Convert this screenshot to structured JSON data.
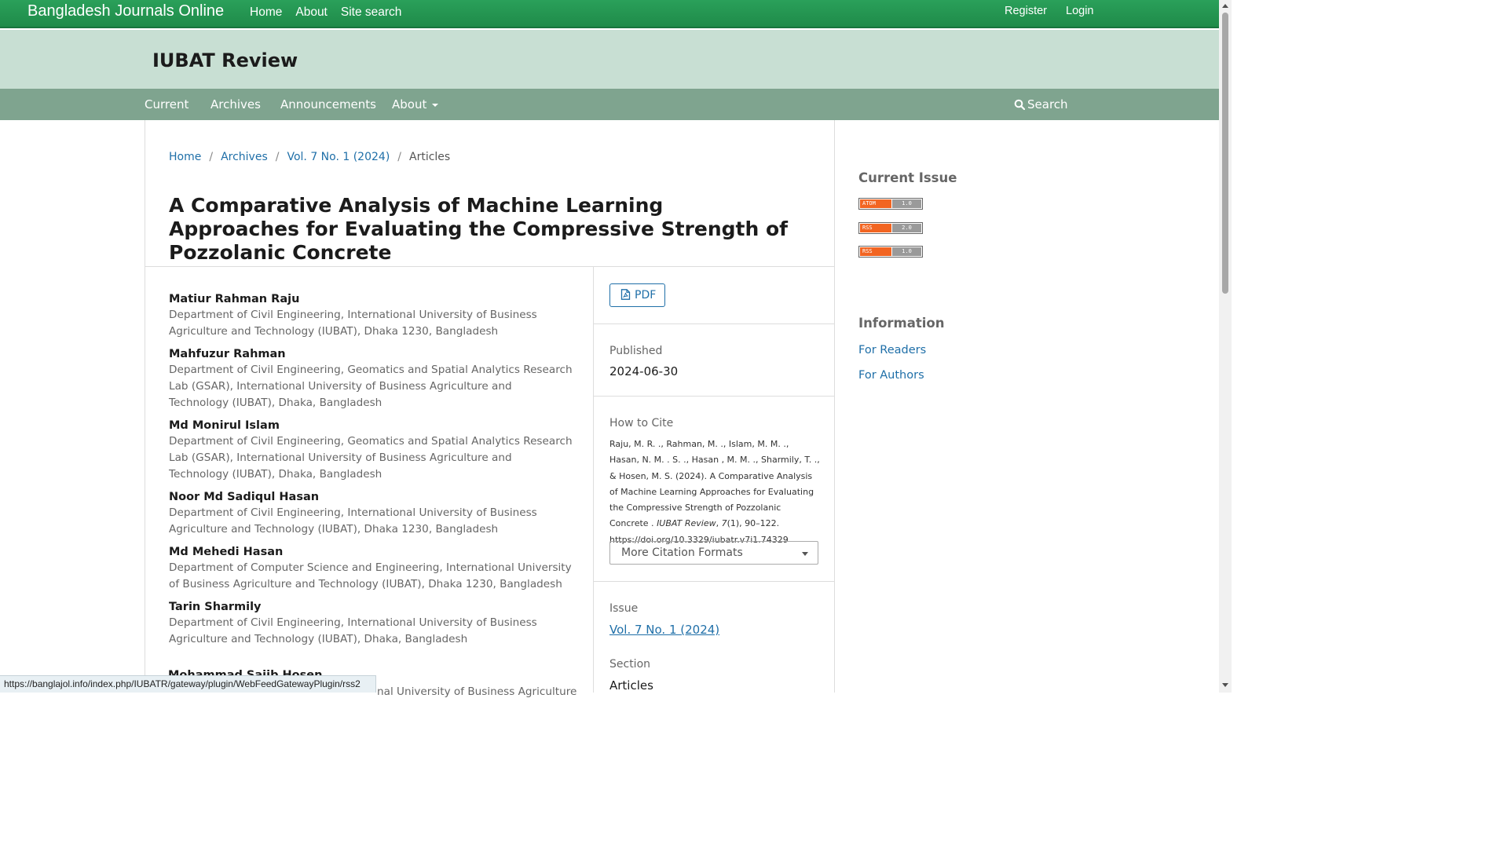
{
  "topbar": {
    "brand": "Bangladesh Journals Online",
    "nav": [
      "Home",
      "About",
      "Site search"
    ],
    "register": "Register",
    "login": "Login"
  },
  "journal": {
    "title": "IUBAT Review"
  },
  "subnav": {
    "current": "Current",
    "archives": "Archives",
    "announcements": "Announcements",
    "about": "About",
    "search": "Search"
  },
  "breadcrumb": {
    "home": "Home",
    "archives": "Archives",
    "issue": "Vol. 7 No. 1 (2024)",
    "current": "Articles",
    "separator": "/"
  },
  "article": {
    "title": "A Comparative Analysis of Machine Learning Approaches for Evaluating the Compressive Strength of Pozzolanic Concrete",
    "authors": [
      {
        "name": "Matiur Rahman Raju",
        "affiliation": "Department of Civil Engineering, International University of Business Agriculture and Technology (IUBAT), Dhaka 1230, Bangladesh"
      },
      {
        "name": "Mahfuzur Rahman",
        "affiliation": "Department of Civil Engineering, Geomatics and Spatial Analytics Research Lab (GSAR), International University of Business Agriculture and Technology (IUBAT), Dhaka, Bangladesh"
      },
      {
        "name": "Md Monirul Islam",
        "affiliation": "Department of Civil Engineering, Geomatics and Spatial Analytics Research Lab (GSAR), International University of Business Agriculture and Technology (IUBAT), Dhaka, Bangladesh"
      },
      {
        "name": "Noor Md Sadiqul Hasan",
        "affiliation": "Department of Civil Engineering, International University of Business Agriculture and Technology (IUBAT), Dhaka 1230, Bangladesh"
      },
      {
        "name": "Md Mehedi Hasan",
        "affiliation": "Department of Computer Science and Engineering, International University of Business Agriculture and Technology (IUBAT), Dhaka 1230, Bangladesh"
      },
      {
        "name": "Tarin Sharmily",
        "affiliation": "Department of Civil Engineering, International University of Business Agriculture and Technology (IUBAT), Dhaka, Bangladesh"
      }
    ],
    "partial_author_name": "Mohammad Sajib Hosen",
    "partial_author_affiliation": "nal University of Business Agriculture"
  },
  "details": {
    "pdf_label": "PDF",
    "published_label": "Published",
    "published_value": "2024-06-30",
    "cite_label": "How to Cite",
    "cite_before": "Raju, M. R. ., Rahman, M. ., Islam, M. M. ., Hasan, N. M. . S. ., Hasan , M. M. ., Sharmily, T. ., & Hosen, M. S. (2024). A Comparative Analysis of Machine Learning Approaches for Evaluating the Compressive Strength of Pozzolanic Concrete . ",
    "cite_journal": "IUBAT Review",
    "cite_comma": ", ",
    "cite_volume": "7",
    "cite_after": "(1), 90–122. https://doi.org/10.3329/iubatr.v7i1.74329",
    "citation_formats": "More Citation Formats",
    "issue_label": "Issue",
    "issue_value": "Vol. 7 No. 1 (2024)",
    "section_label": "Section",
    "section_value": "Articles"
  },
  "sidebar": {
    "current_issue": "Current Issue",
    "feeds": [
      {
        "left": "ATOM",
        "right": "1.0"
      },
      {
        "left": "RSS",
        "right": "2.0"
      },
      {
        "left": "RSS",
        "right": "1.0"
      }
    ],
    "information": "Information",
    "for_readers": "For Readers",
    "for_authors": "For Authors"
  },
  "status_url": "https://banglajol.info/index.php/IUBATR/gateway/plugin/WebFeedGatewayPlugin/rss2",
  "colors": {
    "topbar": "#1f8b49",
    "header_bg": "#c8dfd3",
    "subnav_bg": "#7fa48f",
    "link": "#1f6fa8",
    "feed_orange": "#f26522"
  }
}
